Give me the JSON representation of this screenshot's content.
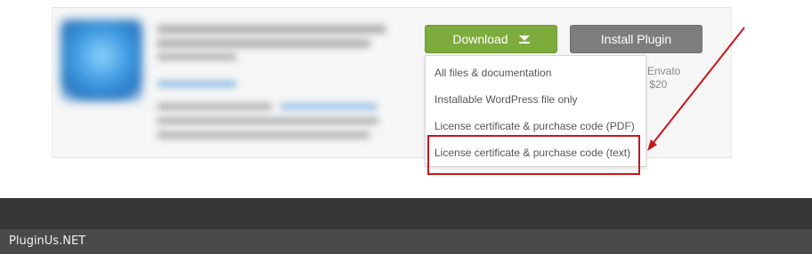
{
  "buttons": {
    "download_label": "Download",
    "install_label": "Install Plugin"
  },
  "dropdown": {
    "items": [
      {
        "label": "All files & documentation"
      },
      {
        "label": "Installable WordPress file only"
      },
      {
        "label": "License certificate & purchase code (PDF)"
      },
      {
        "label": "License certificate & purchase code (text)"
      }
    ]
  },
  "partial": {
    "envato_fragment": "Envato",
    "price_fragment": "r $20"
  },
  "footer": {
    "brand": "PluginUs.NET"
  },
  "colors": {
    "download_green": "#7dab3c",
    "install_gray": "#7d7d7d",
    "annotation_red": "#c8151d",
    "footer_dark": "#363636",
    "footer_darker": "#4a4a4a"
  }
}
